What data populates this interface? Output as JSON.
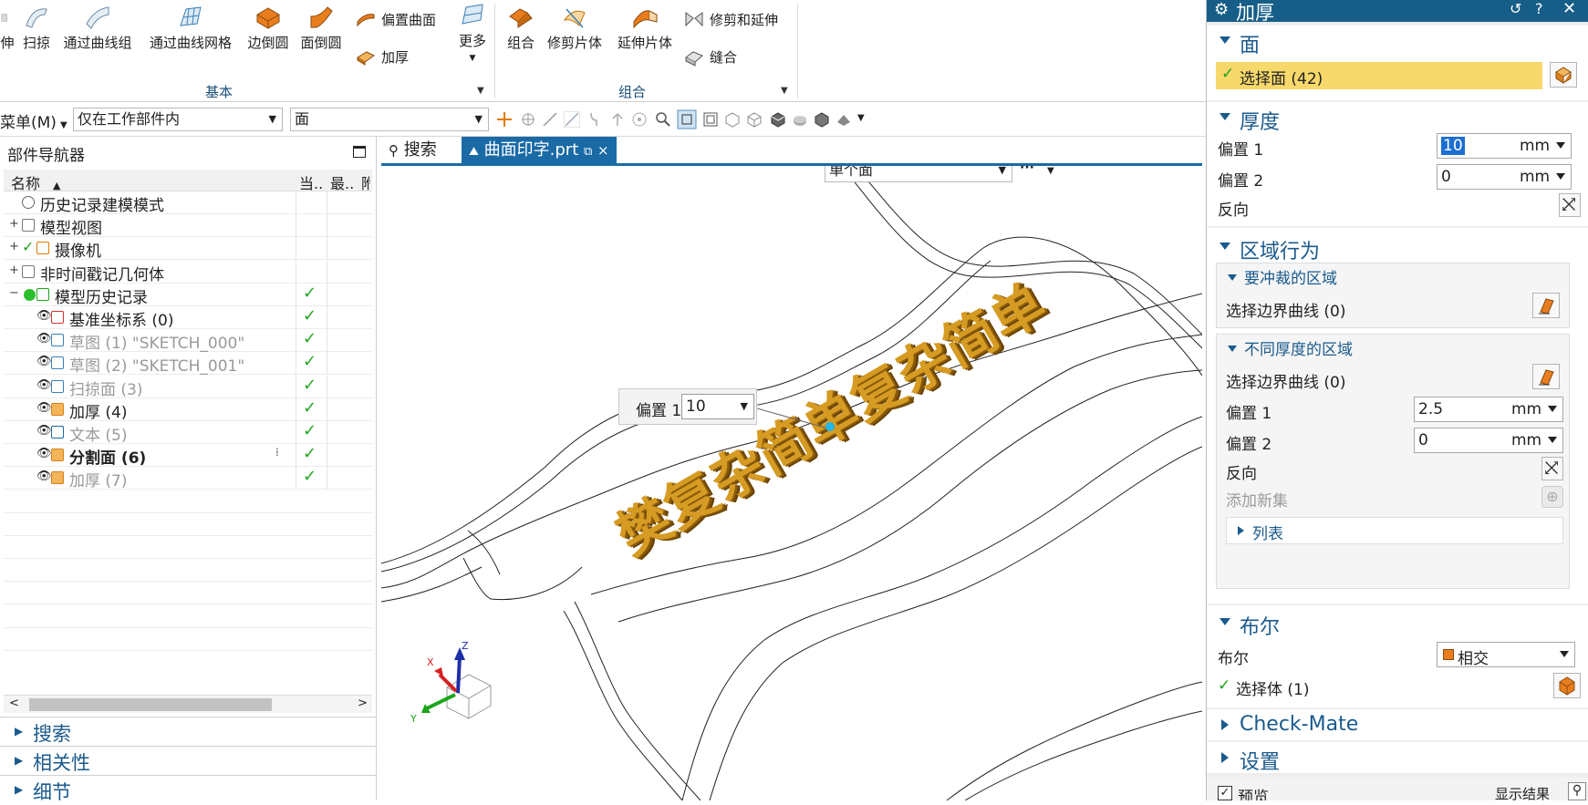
{
  "ribbon": {
    "basic": {
      "buttons": [
        "伸",
        "扫掠",
        "通过曲线组",
        "通过曲线网格",
        "边倒圆",
        "面倒圆"
      ],
      "small": [
        "偏置曲面",
        "加厚"
      ],
      "more": "更多",
      "group_label": "基本"
    },
    "combine": {
      "buttons": [
        "组合",
        "修剪片体",
        "延伸片体"
      ],
      "small": [
        "修剪和延伸",
        "缝合"
      ],
      "group_label": "组合"
    }
  },
  "toolbar": {
    "menu": "菜单(M)",
    "filter_scope": "仅在工作部件内",
    "filter_type": "面"
  },
  "navigator": {
    "title": "部件导航器",
    "columns": {
      "name": "名称",
      "current": "当..",
      "latest": "最..",
      "extra": "附"
    },
    "rows": [
      {
        "label": "历史记录建模模式",
        "style": "normal",
        "check": ""
      },
      {
        "label": "模型视图",
        "style": "normal",
        "check": ""
      },
      {
        "label": "摄像机",
        "style": "normal",
        "check": ""
      },
      {
        "label": "非时间戳记几何体",
        "style": "normal",
        "check": ""
      },
      {
        "label": "模型历史记录",
        "style": "normal",
        "check": "✓"
      },
      {
        "label": "基准坐标系 (0)",
        "style": "normal",
        "check": "✓"
      },
      {
        "label": "草图 (1) \"SKETCH_000\"",
        "style": "gray",
        "check": "✓"
      },
      {
        "label": "草图 (2) \"SKETCH_001\"",
        "style": "gray",
        "check": "✓"
      },
      {
        "label": "扫掠面 (3)",
        "style": "gray",
        "check": "✓"
      },
      {
        "label": "加厚 (4)",
        "style": "normal",
        "check": "✓"
      },
      {
        "label": "文本 (5)",
        "style": "gray",
        "check": "✓"
      },
      {
        "label": "分割面 (6)",
        "style": "bold",
        "check": "✓"
      },
      {
        "label": "加厚 (7)",
        "style": "gray",
        "check": "✓"
      }
    ],
    "sections": [
      "搜索",
      "相关性",
      "细节"
    ]
  },
  "tabs": {
    "search": "搜索",
    "file": "曲面印字.prt"
  },
  "viewport": {
    "selection_mode": "单个面",
    "ellipsis": "···",
    "overlay_label": "偏置 1",
    "overlay_value": "10",
    "text_3d": "樊复杂简单复杂简单",
    "axis": {
      "x": "X",
      "y": "Y",
      "z": "Z"
    }
  },
  "dialog": {
    "title": "加厚",
    "face": {
      "header": "面",
      "select": "选择面 (42)"
    },
    "thickness": {
      "header": "厚度",
      "offset1_label": "偏置 1",
      "offset1_value": "10",
      "offset1_unit": "mm",
      "offset2_label": "偏置 2",
      "offset2_value": "0",
      "offset2_unit": "mm",
      "reverse": "反向"
    },
    "region": {
      "header": "区域行为",
      "punch": {
        "header": "要冲裁的区域",
        "select": "选择边界曲线 (0)"
      },
      "diff": {
        "header": "不同厚度的区域",
        "select": "选择边界曲线 (0)",
        "offset1_label": "偏置 1",
        "offset1_value": "2.5",
        "offset1_unit": "mm",
        "offset2_label": "偏置 2",
        "offset2_value": "0",
        "offset2_unit": "mm",
        "reverse": "反向",
        "add_set": "添加新集",
        "list": "列表"
      }
    },
    "boolean": {
      "header": "布尔",
      "label": "布尔",
      "value": "相交",
      "select": "选择体 (1)"
    },
    "checkmate": "Check-Mate",
    "settings": "设置",
    "preview": "预览",
    "show_result": "显示结果"
  },
  "colors": {
    "accent": "#165e87",
    "highlight": "#f7d86a",
    "gold": "#c8901a",
    "check": "#1aa51a"
  }
}
